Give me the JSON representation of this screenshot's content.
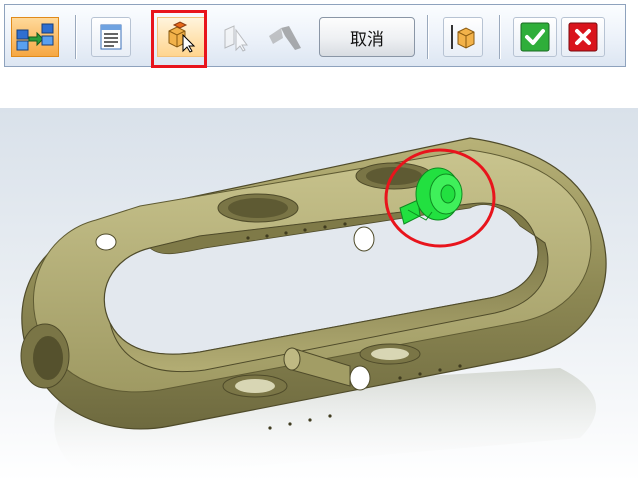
{
  "toolbar": {
    "buttons": [
      {
        "name": "assembly-icon",
        "state": "active"
      },
      {
        "name": "properties-icon",
        "state": "normal"
      },
      {
        "name": "select-part-icon",
        "state": "highlighted"
      },
      {
        "name": "select-face-icon",
        "state": "disabled"
      },
      {
        "name": "select-tool-icon",
        "state": "disabled"
      }
    ],
    "cancel_label": "取消",
    "part_button": "part-icon",
    "accept_button": "accept-icon",
    "close_button": "close-icon"
  },
  "colors": {
    "highlight_outline": "#e8141c",
    "selected_feature": "#22e040",
    "part_body": "#9a9560",
    "toolbar_accent": "#f6a742"
  }
}
